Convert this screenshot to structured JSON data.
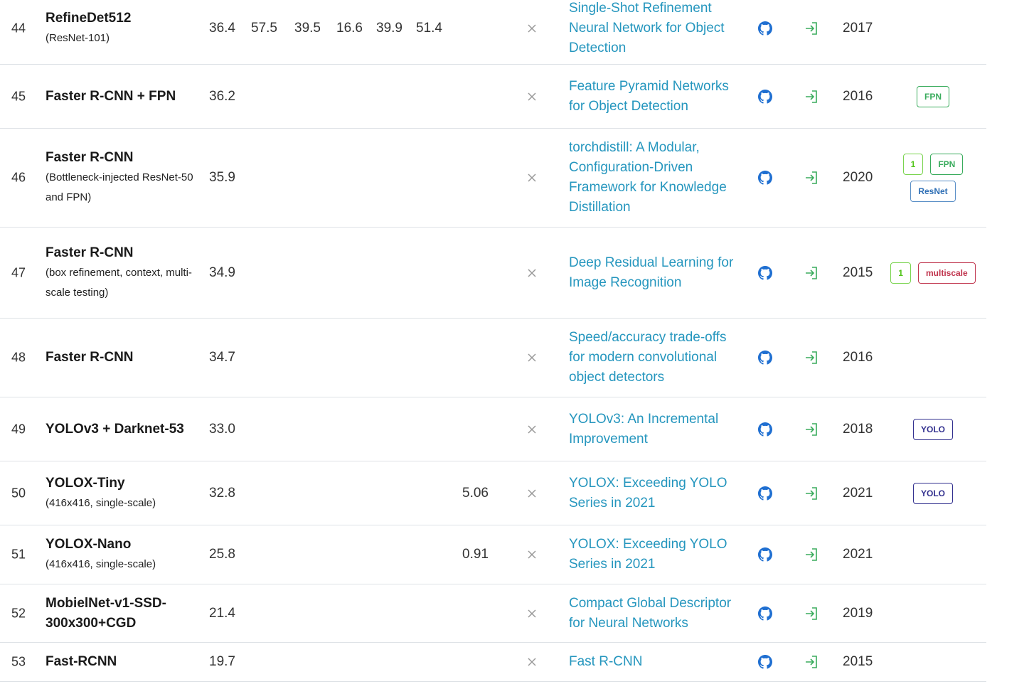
{
  "colors": {
    "link": "#2596be",
    "github": "#1f6fd1",
    "exit": "#3aac5d",
    "x": "#999999"
  },
  "icons": {
    "github": "github-icon",
    "paper": "exit-arrow-icon",
    "extra": "close-x-icon"
  },
  "rows": [
    {
      "rank": "44",
      "model": "RefineDet512",
      "sub": "(ResNet-101)",
      "metrics": [
        "36.4",
        "57.5",
        "39.5",
        "16.6",
        "39.9",
        "51.4"
      ],
      "params": "",
      "paper": "Single-Shot Refinement Neural Network for Object Detection",
      "year": "2017",
      "tags": []
    },
    {
      "rank": "45",
      "model": "Faster R-CNN + FPN",
      "sub": "",
      "metrics": [
        "36.2"
      ],
      "params": "",
      "paper": "Feature Pyramid Networks for Object Detection",
      "year": "2016",
      "tags": [
        {
          "label": "FPN",
          "style": "green"
        }
      ]
    },
    {
      "rank": "46",
      "model": "Faster R-CNN",
      "sub": "(Bottleneck-injected ResNet-50 and FPN)",
      "metrics": [
        "35.9"
      ],
      "params": "",
      "paper": "torchdistill: A Modular, Configuration-Driven Framework for Knowledge Distillation",
      "year": "2020",
      "tags": [
        {
          "label": "1",
          "style": "lime"
        },
        {
          "label": "FPN",
          "style": "green"
        },
        {
          "label": "ResNet",
          "style": "blue"
        }
      ]
    },
    {
      "rank": "47",
      "model": "Faster R-CNN",
      "sub": "(box refinement, context, multi-scale testing)",
      "metrics": [
        "34.9"
      ],
      "params": "",
      "paper": "Deep Residual Learning for Image Recognition",
      "year": "2015",
      "tags": [
        {
          "label": "1",
          "style": "lime"
        },
        {
          "label": "multiscale",
          "style": "red"
        }
      ]
    },
    {
      "rank": "48",
      "model": "Faster R-CNN",
      "sub": "",
      "metrics": [
        "34.7"
      ],
      "params": "",
      "paper": "Speed/accuracy trade-offs for modern convolutional object detectors",
      "year": "2016",
      "tags": []
    },
    {
      "rank": "49",
      "model": "YOLOv3 + Darknet-53",
      "sub": "",
      "metrics": [
        "33.0"
      ],
      "params": "",
      "paper": "YOLOv3: An Incremental Improvement",
      "year": "2018",
      "tags": [
        {
          "label": "YOLO",
          "style": "purple"
        }
      ]
    },
    {
      "rank": "50",
      "model": "YOLOX-Tiny",
      "sub": "(416x416, single-scale)",
      "metrics": [
        "32.8"
      ],
      "params": "5.06",
      "paper": "YOLOX: Exceeding YOLO Series in 2021",
      "year": "2021",
      "tags": [
        {
          "label": "YOLO",
          "style": "purple"
        }
      ]
    },
    {
      "rank": "51",
      "model": "YOLOX-Nano",
      "sub": "(416x416, single-scale)",
      "metrics": [
        "25.8"
      ],
      "params": "0.91",
      "paper": "YOLOX: Exceeding YOLO Series in 2021",
      "year": "2021",
      "tags": []
    },
    {
      "rank": "52",
      "model": "MobielNet-v1-SSD-300x300+CGD",
      "sub": "",
      "metrics": [
        "21.4"
      ],
      "params": "",
      "paper": "Compact Global Descriptor for Neural Networks",
      "year": "2019",
      "tags": []
    },
    {
      "rank": "53",
      "model": "Fast-RCNN",
      "sub": "",
      "metrics": [
        "19.7"
      ],
      "params": "",
      "paper": "Fast R-CNN",
      "year": "2015",
      "tags": []
    }
  ]
}
